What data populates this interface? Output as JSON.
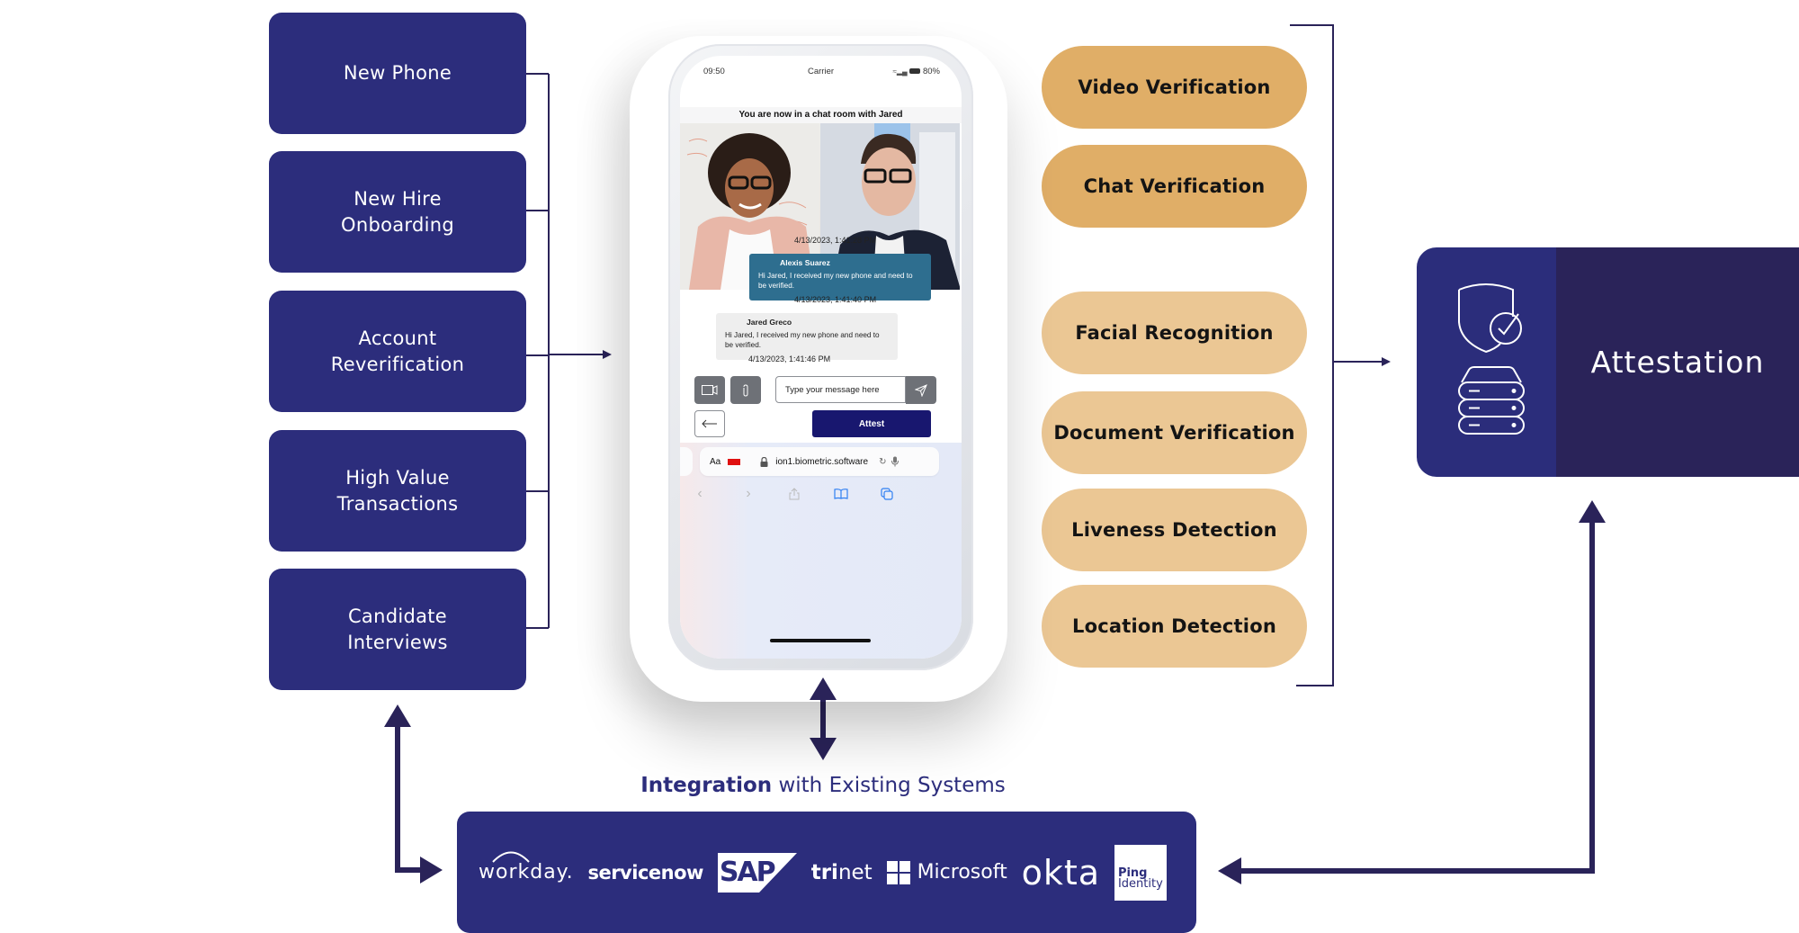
{
  "use_cases": [
    {
      "label": "New Phone"
    },
    {
      "label": "New Hire\nOnboarding"
    },
    {
      "label": "Account\nReverification"
    },
    {
      "label": "High Value\nTransactions"
    },
    {
      "label": "Candidate\nInterviews"
    }
  ],
  "capabilities": [
    {
      "label": "Video Verification",
      "tone": "dark"
    },
    {
      "label": "Chat Verification",
      "tone": "dark"
    },
    {
      "label": "Facial Recognition",
      "tone": "light"
    },
    {
      "label": "Document Verification",
      "tone": "light"
    },
    {
      "label": "Liveness Detection",
      "tone": "light"
    },
    {
      "label": "Location Detection",
      "tone": "light"
    }
  ],
  "attestation": {
    "label": "Attestation",
    "icons": [
      "shield-check-icon",
      "server-stack-icon"
    ]
  },
  "phone": {
    "status": {
      "time": "09:50",
      "carrier": "Carrier",
      "battery": "80%"
    },
    "room_header": "You are now in a chat room with Jared",
    "video_participants": [
      "Alexis Suarez",
      "Jared Greco"
    ],
    "messages": [
      {
        "timestamp": "4/13/2023, 1:41:28 PM"
      },
      {
        "sender": "Alexis Suarez",
        "text": "Hi Jared, I received my new phone and need to be verified.",
        "direction": "outgoing"
      },
      {
        "timestamp": "4/13/2023, 1:41:40 PM"
      },
      {
        "sender": "Jared Greco",
        "text": "Hi Jared, I received my new phone and need to be verified.",
        "direction": "incoming"
      },
      {
        "timestamp": "4/13/2023, 1:41:46 PM"
      }
    ],
    "input_placeholder": "Type your message here",
    "attest_button": "Attest",
    "browser": {
      "text_size": "Aa",
      "url": "ion1.biometric.software"
    }
  },
  "integration": {
    "title_bold": "Integration",
    "title_rest": " with Existing Systems",
    "logos": [
      {
        "name": "workday",
        "text": "workday."
      },
      {
        "name": "servicenow",
        "text": "servicenow"
      },
      {
        "name": "sap",
        "text": "SAP"
      },
      {
        "name": "trinet",
        "text_bold": "tri",
        "text_rest": "net"
      },
      {
        "name": "microsoft",
        "text": "Microsoft"
      },
      {
        "name": "okta",
        "text": "okta"
      },
      {
        "name": "ping-identity",
        "line1": "Ping",
        "line2": "Identity"
      }
    ]
  },
  "colors": {
    "navy": "#2c2d7c",
    "deep_navy": "#2a2359",
    "arrow": "#2a2359",
    "gold_dark": "#e0ae67",
    "gold_light": "#ebc794",
    "chat_out": "#2e6e8f",
    "attest_btn": "#18176f"
  }
}
